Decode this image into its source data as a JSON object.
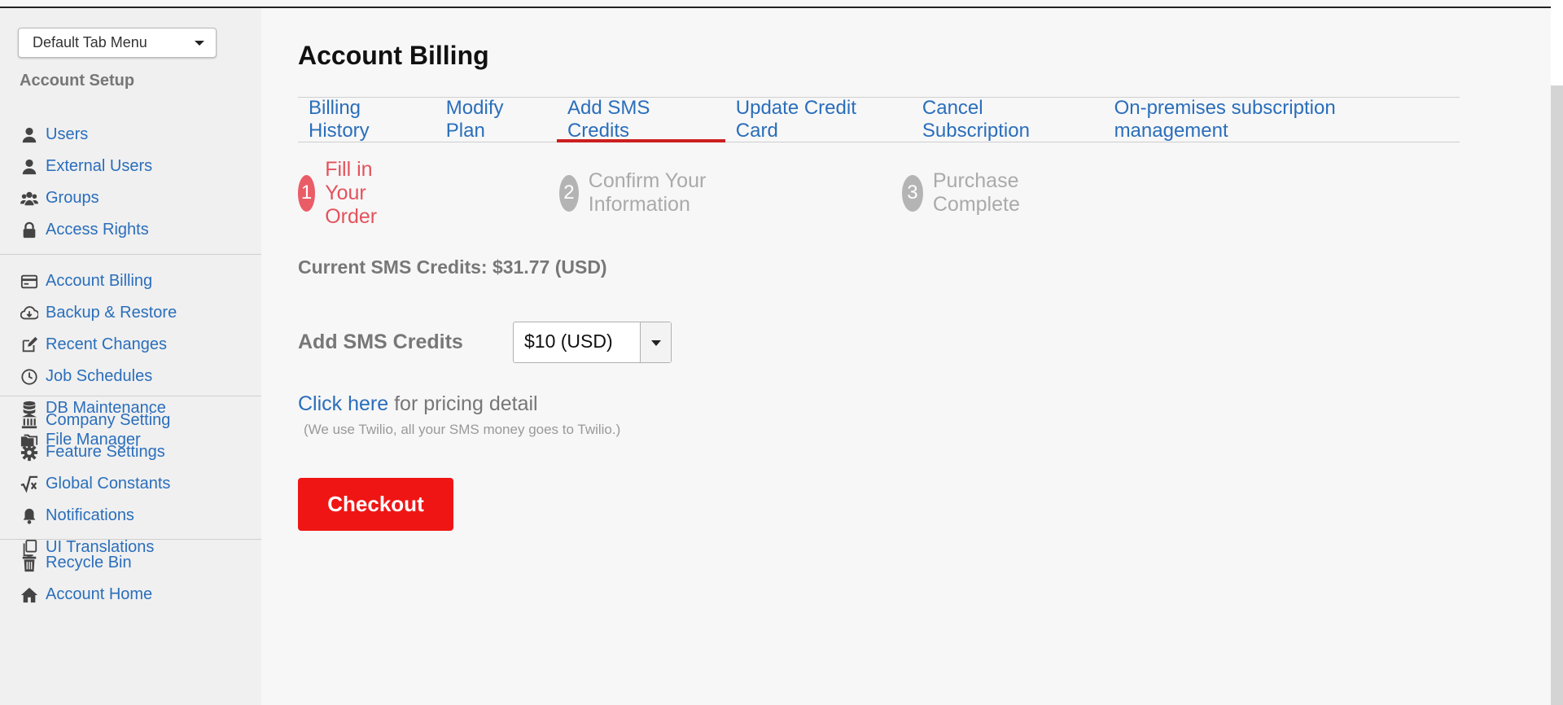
{
  "tab_menu": {
    "label": "Default Tab Menu"
  },
  "sidebar": {
    "section_title": "Account Setup",
    "groups": [
      [
        {
          "label": "Users",
          "icon": "user-icon"
        },
        {
          "label": "External Users",
          "icon": "user-icon"
        },
        {
          "label": "Groups",
          "icon": "users-icon"
        },
        {
          "label": "Access Rights",
          "icon": "lock-icon"
        }
      ],
      [
        {
          "label": "Account Billing",
          "icon": "credit-card-icon"
        },
        {
          "label": "Backup & Restore",
          "icon": "cloud-download-icon"
        },
        {
          "label": "Recent Changes",
          "icon": "edit-icon"
        },
        {
          "label": "Job Schedules",
          "icon": "clock-icon"
        },
        {
          "label": "DB Maintenance",
          "icon": "database-icon"
        },
        {
          "label": "File Manager",
          "icon": "folders-icon"
        }
      ],
      [
        {
          "label": "Company Setting",
          "icon": "bank-icon"
        },
        {
          "label": "Feature Settings",
          "icon": "gear-icon"
        },
        {
          "label": "Global Constants",
          "icon": "square-root-icon"
        },
        {
          "label": "Notifications",
          "icon": "bell-icon"
        },
        {
          "label": "UI Translations",
          "icon": "copy-icon"
        }
      ],
      [
        {
          "label": "Recycle Bin",
          "icon": "trash-icon"
        },
        {
          "label": "Account Home",
          "icon": "home-icon"
        }
      ]
    ]
  },
  "page": {
    "title": "Account Billing"
  },
  "tabs": [
    {
      "label": "Billing History",
      "active": false
    },
    {
      "label": "Modify Plan",
      "active": false
    },
    {
      "label": "Add SMS Credits",
      "active": true
    },
    {
      "label": "Update Credit Card",
      "active": false
    },
    {
      "label": "Cancel Subscription",
      "active": false
    },
    {
      "label": "On-premises subscription management",
      "active": false
    }
  ],
  "steps": [
    {
      "num": "1",
      "label": "Fill in Your Order",
      "state": "active"
    },
    {
      "num": "2",
      "label": "Confirm Your Information",
      "state": "inactive"
    },
    {
      "num": "3",
      "label": "Purchase Complete",
      "state": "inactive"
    }
  ],
  "form": {
    "current_credits": "Current SMS Credits: $31.77 (USD)",
    "add_label": "Add SMS Credits",
    "selected_amount": "$10 (USD)",
    "pricing_link": "Click here",
    "pricing_text": " for pricing detail",
    "note": "(We use Twilio, all your SMS money goes to Twilio.)",
    "checkout_label": "Checkout"
  },
  "colors": {
    "link": "#2a6ebb",
    "active_tab_underline": "#cc1f1f",
    "active_step": "#ea5c66",
    "checkout": "#f01515"
  }
}
